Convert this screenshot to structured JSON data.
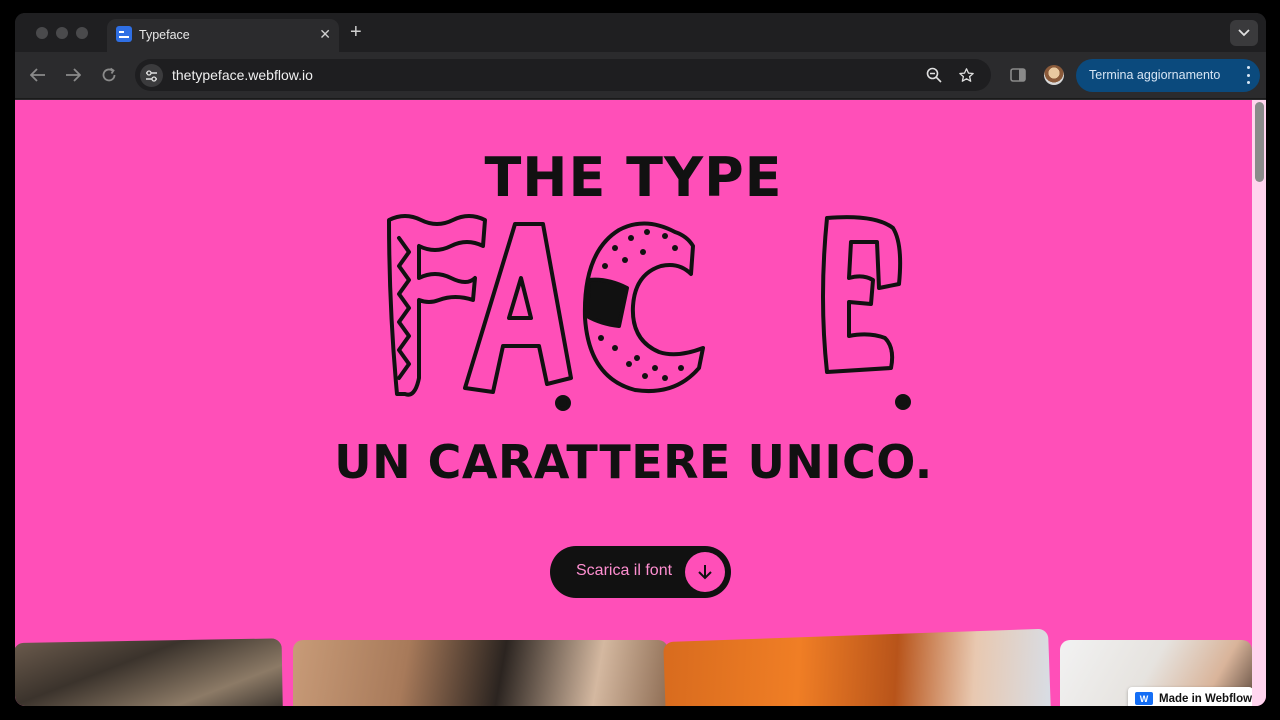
{
  "browser": {
    "tab": {
      "title": "Typeface",
      "close_glyph": "✕"
    },
    "new_tab_glyph": "+",
    "address": {
      "url": "thetypeface.webflow.io"
    },
    "update_button": {
      "label": "Termina aggiornamento"
    }
  },
  "hero": {
    "line1": "THE TYPE",
    "art_word": "FACE",
    "line3": "UN CARATTERE UNICO.",
    "cta_label": "Scarica il font"
  },
  "badge": {
    "label": "Made in Webflow",
    "icon_letter": "W"
  },
  "colors": {
    "page_bg": "#ff4fb8",
    "ink": "#111111",
    "cta_text": "#ff8fd1",
    "update_bg": "#0b4a7d",
    "webflow_blue": "#146ef5"
  },
  "icons": [
    "back-arrow-icon",
    "forward-arrow-icon",
    "reload-icon",
    "site-info-icon",
    "zoom-icon",
    "star-icon",
    "side-panel-icon",
    "kebab-menu-icon",
    "down-arrow-icon",
    "chevron-down-icon"
  ]
}
